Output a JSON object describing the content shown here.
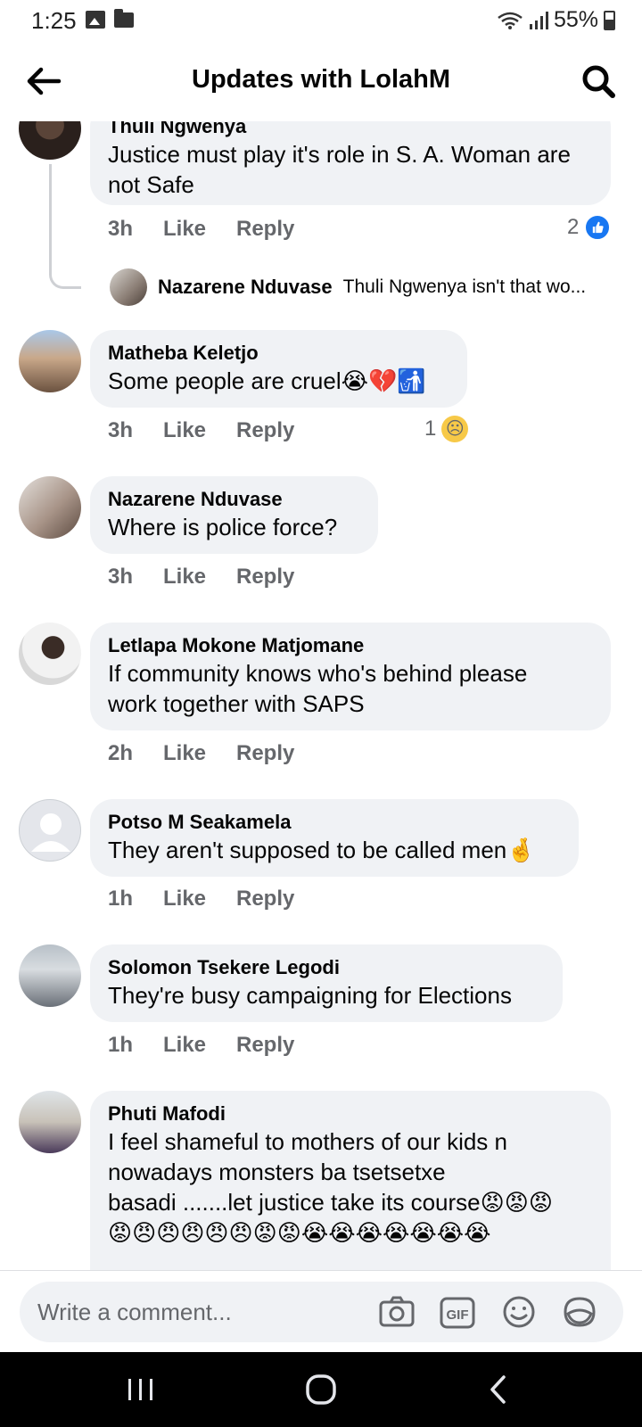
{
  "status_bar": {
    "time": "1:25",
    "battery": "55%"
  },
  "header": {
    "title": "Updates with LolahM"
  },
  "actions": {
    "like": "Like",
    "reply": "Reply"
  },
  "comments": [
    {
      "name": "Thuli Ngwenya",
      "lines": [
        "Justice must play it's role in S. A. Woman are",
        "not Safe"
      ],
      "time": "3h",
      "reaction_count": "2"
    },
    {
      "name": "Matheba Keletjo",
      "lines": [
        "Some people are cruel😭💔🚮"
      ],
      "time": "3h",
      "reaction_count": "1"
    },
    {
      "name": "Nazarene Nduvase",
      "lines": [
        "Where is police force?"
      ],
      "time": "3h"
    },
    {
      "name": "Letlapa Mokone Matjomane",
      "lines": [
        "If community knows who's behind please",
        "work together with SAPS"
      ],
      "time": "2h"
    },
    {
      "name": "Potso M Seakamela",
      "lines": [
        "They aren't supposed to be called men🤞"
      ],
      "time": "1h"
    },
    {
      "name": "Solomon Tsekere Legodi",
      "lines": [
        "They're busy campaigning for Elections"
      ],
      "time": "1h"
    },
    {
      "name": "Phuti Mafodi",
      "lines": [
        "I feel shameful to mothers of our kids n",
        "nowadays monsters ba tsetsetxe",
        "basadi .......let justice take its course😡😡😡",
        "😡😠😠😠😠😠😡😡😭😭😭😭😭😭😭"
      ]
    }
  ],
  "reply_preview": {
    "name": "Nazarene Nduvase",
    "text": "Thuli Ngwenya isn't that wo..."
  },
  "composer": {
    "placeholder": "Write a comment..."
  }
}
